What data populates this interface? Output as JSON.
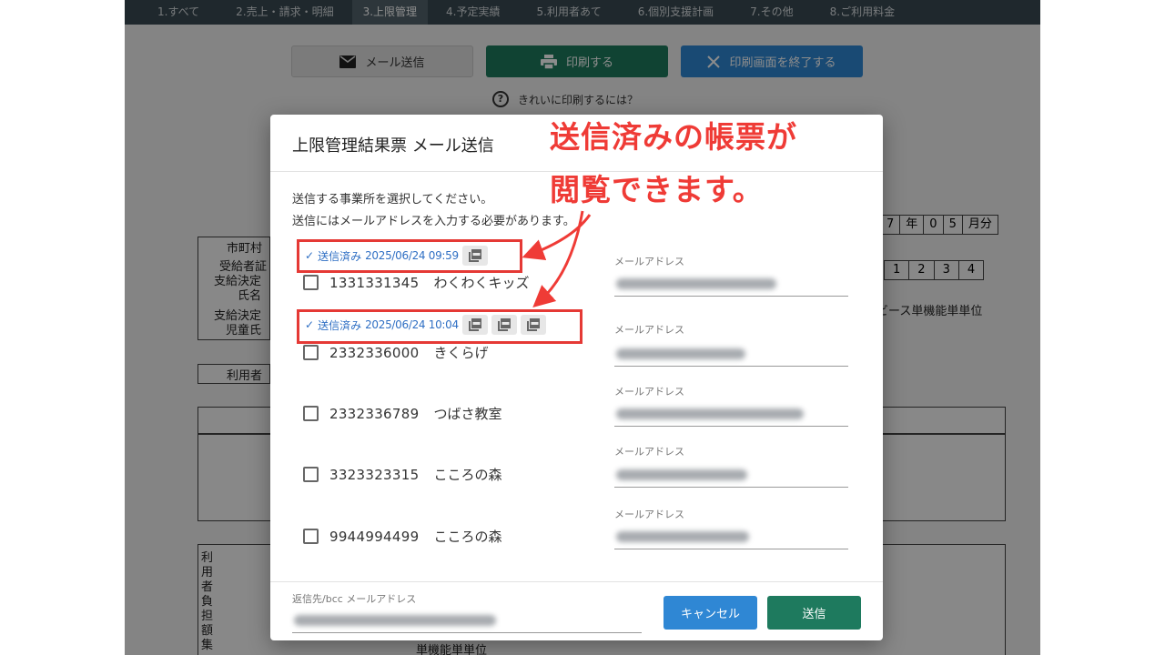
{
  "nav": {
    "items": [
      "1.すべて",
      "2.売上・請求・明細",
      "3.上限管理",
      "4.予定実績",
      "5.利用者あて",
      "6.個別支援計画",
      "7.その他",
      "8.ご利用料金"
    ],
    "active_index": 2
  },
  "toolbar": {
    "mail_label": "メール送信",
    "print_label": "印刷する",
    "end_print_label": "印刷画面を終了する",
    "howto_label": "きれいに印刷するには？"
  },
  "background_form": {
    "city": "市町村",
    "recipient": "受給者証",
    "decision_name": "支給決定者\n氏名",
    "decision_child": "支給決定\n児童氏",
    "user": "利用者",
    "date_cells": [
      "7",
      "年",
      "0",
      "5",
      "月分"
    ],
    "number_cells": [
      "1",
      "2",
      "3",
      "4"
    ],
    "service_text": "ビース単機能単単位",
    "vertical_text": "利用者負担額集",
    "bottom_text": "単機能単単位"
  },
  "modal": {
    "title": "上限管理結果票 メール送信",
    "instruction_1": "送信する事業所を選択してください。",
    "instruction_2": "送信にはメールアドレスを入力する必要があります。",
    "email_label": "メールアドレス",
    "entries": [
      {
        "sent": true,
        "sent_text": "送信済み",
        "sent_at": "2025/06/24 09:59",
        "pdf_count": 1,
        "code": "1331331345",
        "name": "わくわくキッズ"
      },
      {
        "sent": true,
        "sent_text": "送信済み",
        "sent_at": "2025/06/24 10:04",
        "pdf_count": 3,
        "code": "2332336000",
        "name": "きくらげ"
      },
      {
        "sent": false,
        "code": "2332336789",
        "name": "つばさ教室"
      },
      {
        "sent": false,
        "code": "3323323315",
        "name": "こころの森"
      },
      {
        "sent": false,
        "code": "9944994499",
        "name": "こころの森"
      }
    ],
    "bcc_label": "返信先/bcc メールアドレス",
    "cancel_label": "キャンセル",
    "send_label": "送信"
  },
  "annotation": {
    "line_1": "送信済みの帳票が",
    "line_2": "閲覧できます。",
    "color": "#ef3b36"
  }
}
